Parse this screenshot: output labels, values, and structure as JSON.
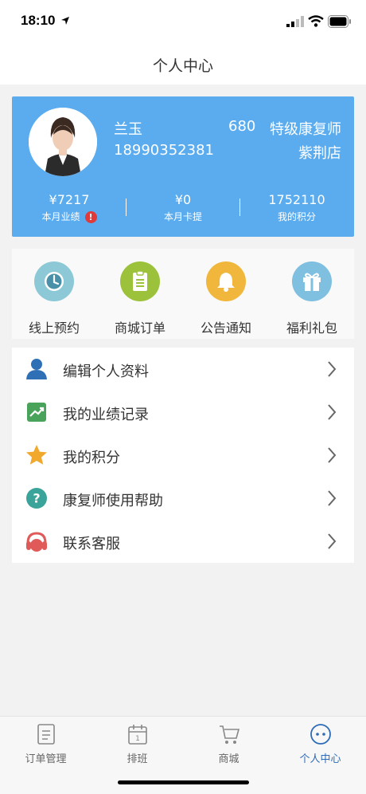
{
  "status_bar": {
    "time": "18:10"
  },
  "header": {
    "title": "个人中心"
  },
  "profile": {
    "name": "兰玉",
    "score": "680",
    "level": "特级康复师",
    "phone": "18990352381",
    "store": "紫荆店",
    "stats": [
      {
        "value": "¥7217",
        "label": "本月业绩",
        "badge": "!"
      },
      {
        "value": "¥0",
        "label": "本月卡提"
      },
      {
        "value": "1752110",
        "label": "我的积分"
      }
    ]
  },
  "quick_actions": [
    {
      "label": "线上预约",
      "icon": "clock-icon",
      "color": "#8cc8d6"
    },
    {
      "label": "商城订单",
      "icon": "clipboard-icon",
      "color": "#9bc23a"
    },
    {
      "label": "公告通知",
      "icon": "bell-icon",
      "color": "#f0b73c"
    },
    {
      "label": "福利礼包",
      "icon": "gift-icon",
      "color": "#7fbfdf"
    }
  ],
  "menu": [
    {
      "label": "编辑个人资料",
      "icon": "user-icon"
    },
    {
      "label": "我的业绩记录",
      "icon": "trend-chart-icon"
    },
    {
      "label": "我的积分",
      "icon": "star-icon"
    },
    {
      "label": "康复师使用帮助",
      "icon": "help-icon"
    },
    {
      "label": "联系客服",
      "icon": "headset-icon"
    }
  ],
  "tabs": [
    {
      "label": "订单管理",
      "icon": "document-icon",
      "active": false
    },
    {
      "label": "排班",
      "icon": "calendar-icon",
      "active": false
    },
    {
      "label": "商城",
      "icon": "cart-icon",
      "active": false
    },
    {
      "label": "个人中心",
      "icon": "chat-bubble-icon",
      "active": true
    }
  ],
  "colors": {
    "card": "#5aacef",
    "active_tab": "#2d6bb8",
    "badge": "#e03a3a"
  }
}
